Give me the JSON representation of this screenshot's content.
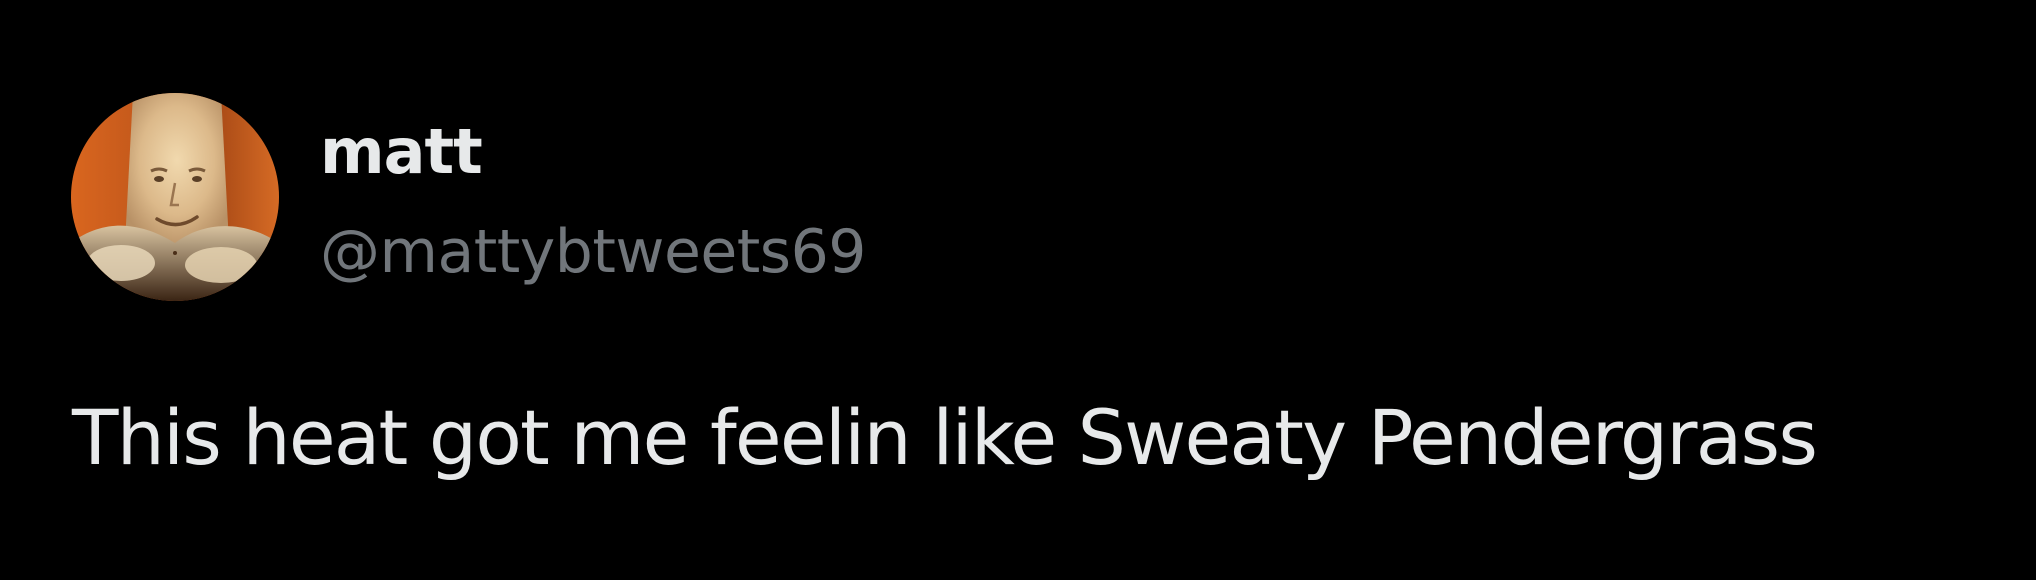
{
  "theme": {
    "background": "#000000",
    "primary_text": "#e7e9ea",
    "secondary_text": "#71767b"
  },
  "author": {
    "avatar_icon": "avatar-photo",
    "display_name": "matt",
    "handle": "@mattybtweets69"
  },
  "tweet": {
    "text": "This heat got me feelin like Sweaty Pendergrass"
  }
}
